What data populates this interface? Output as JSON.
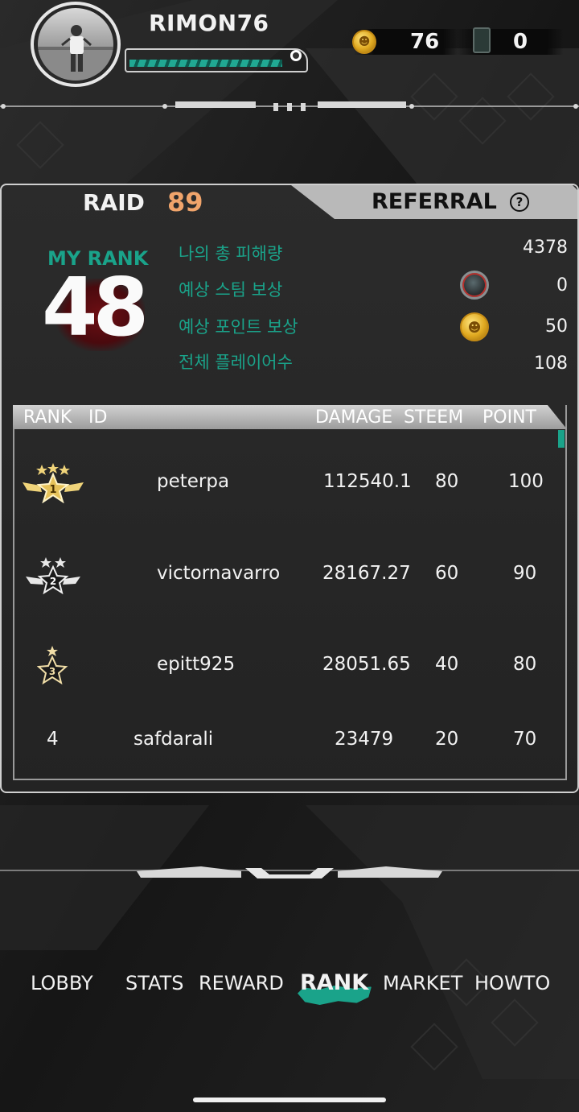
{
  "header": {
    "username": "RIMON76",
    "xp_progress": 0.95,
    "coins": "76",
    "cards": "0"
  },
  "tabs": {
    "raid_label": "RAID",
    "raid_number": "89",
    "referral_label": "REFERRAL",
    "help_glyph": "?"
  },
  "my_rank": {
    "label": "MY RANK",
    "value": "48"
  },
  "stats": [
    {
      "label": "나의 총 피해량",
      "value": "4378"
    },
    {
      "label": "예상 스팀 보상",
      "value": "0"
    },
    {
      "label": "예상 포인트 보상",
      "value": "50"
    },
    {
      "label": "전체 플레이어수",
      "value": "108"
    }
  ],
  "table": {
    "headers": [
      "RANK",
      "ID",
      "DAMAGE",
      "STEEM",
      "POINT"
    ],
    "rows": [
      {
        "rank": "1",
        "id": "peterpa",
        "damage": "112540.1",
        "steem": "80",
        "point": "100"
      },
      {
        "rank": "2",
        "id": "victornavarro",
        "damage": "28167.27",
        "steem": "60",
        "point": "90"
      },
      {
        "rank": "3",
        "id": "epitt925",
        "damage": "28051.65",
        "steem": "40",
        "point": "80"
      },
      {
        "rank": "4",
        "id": "safdarali",
        "damage": "23479",
        "steem": "20",
        "point": "70"
      }
    ]
  },
  "nav": {
    "items": [
      "LOBBY",
      "STATS",
      "REWARD",
      "RANK",
      "MARKET",
      "HOWTO"
    ],
    "active": "RANK"
  },
  "colors": {
    "accent": "#1aa38a",
    "raid_number": "#f0a46b",
    "background": "#1a1a1a"
  },
  "icons": [
    "coin-icon",
    "card-icon",
    "steem-icon",
    "point-coin-icon",
    "help-icon",
    "gold-rank-badge-icon",
    "silver-rank-badge-icon",
    "bronze-rank-badge-icon"
  ]
}
